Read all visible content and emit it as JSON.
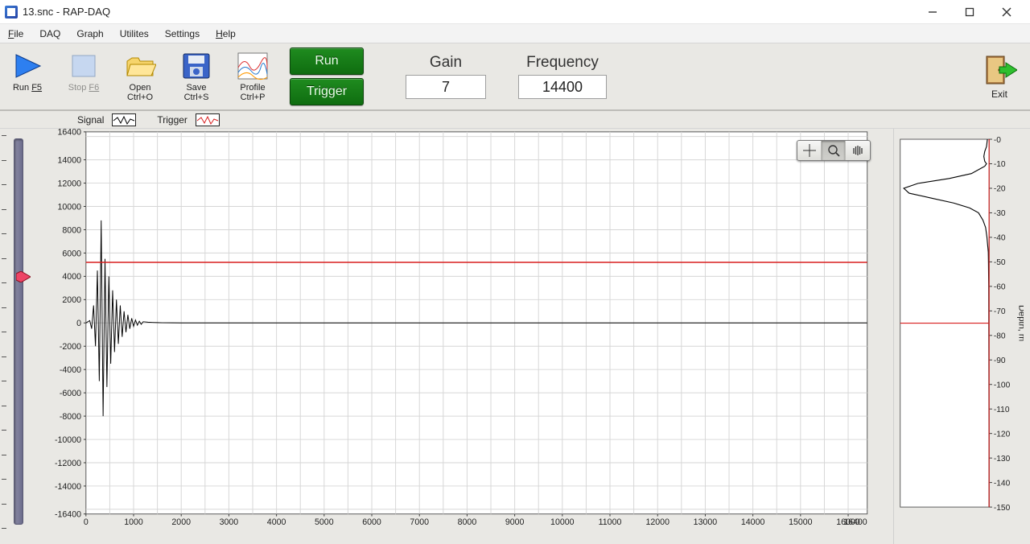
{
  "window": {
    "title": "13.snc  -  RAP-DAQ"
  },
  "menubar": [
    {
      "label": "File",
      "accel": "F"
    },
    {
      "label": "DAQ",
      "accel": ""
    },
    {
      "label": "Graph",
      "accel": ""
    },
    {
      "label": "Utilites",
      "accel": ""
    },
    {
      "label": "Settings",
      "accel": ""
    },
    {
      "label": "Help",
      "accel": "H"
    }
  ],
  "toolbar": {
    "run": {
      "label": "Run ",
      "key": "F5"
    },
    "stop": {
      "label": "Stop ",
      "key": "F6"
    },
    "open": {
      "label": "Open\nCtrl+O"
    },
    "save": {
      "label": "Save\nCtrl+S"
    },
    "profile": {
      "label": "Profile\nCtrl+P"
    },
    "run_btn": "Run",
    "trigger_btn": "Trigger",
    "gain_label": "Gain",
    "gain_value": "7",
    "freq_label": "Frequency",
    "freq_value": "14400",
    "exit_label": "Exit"
  },
  "legend": {
    "signal": "Signal",
    "trigger": "Trigger"
  },
  "depth_axis_label": "Depth, m",
  "chart_data": [
    {
      "type": "line",
      "title": "",
      "xlabel": "",
      "ylabel": "",
      "xlim": [
        0,
        16400
      ],
      "ylim": [
        -16400,
        16400
      ],
      "xticks": [
        0,
        1000,
        2000,
        3000,
        4000,
        5000,
        6000,
        7000,
        8000,
        9000,
        10000,
        11000,
        12000,
        13000,
        14000,
        15000,
        16000,
        16400
      ],
      "yticks": [
        -16400,
        -14000,
        -12000,
        -10000,
        -8000,
        -6000,
        -4000,
        -2000,
        0,
        2000,
        4000,
        6000,
        8000,
        10000,
        12000,
        14000,
        16400
      ],
      "series": [
        {
          "name": "Signal",
          "color": "#000000",
          "x": [
            0,
            80,
            120,
            160,
            200,
            240,
            280,
            320,
            360,
            400,
            440,
            480,
            520,
            560,
            600,
            640,
            680,
            720,
            760,
            800,
            840,
            880,
            920,
            960,
            1000,
            1040,
            1080,
            1120,
            1160,
            1200,
            1300,
            1400,
            1500,
            1600,
            1800,
            2000,
            2500,
            3000,
            4000,
            5000,
            7000,
            9000,
            12000,
            16400
          ],
          "values": [
            0,
            200,
            -500,
            1500,
            -2000,
            4500,
            -5000,
            8800,
            -8000,
            5500,
            -5500,
            4000,
            -3500,
            2800,
            -2500,
            2000,
            -1800,
            1500,
            -1200,
            1000,
            -800,
            700,
            -500,
            400,
            -300,
            250,
            -200,
            150,
            -120,
            100,
            60,
            40,
            25,
            15,
            10,
            5,
            3,
            0,
            2,
            0,
            1,
            0,
            0,
            0
          ]
        },
        {
          "name": "Trigger",
          "color": "#d81e1e",
          "x": [
            0,
            16400
          ],
          "values": [
            5200,
            5200
          ]
        }
      ]
    },
    {
      "type": "line",
      "title": "",
      "xlabel": "",
      "ylabel": "Depth, m",
      "xlim": [
        0,
        1
      ],
      "ylim": [
        150,
        0
      ],
      "yticks": [
        0,
        10,
        20,
        30,
        40,
        50,
        60,
        70,
        80,
        90,
        100,
        110,
        120,
        130,
        140,
        150
      ],
      "series": [
        {
          "name": "Profile",
          "color": "#000000",
          "y": [
            0,
            3,
            5,
            7,
            9,
            10,
            11,
            12,
            14,
            16,
            18,
            20,
            22,
            24,
            26,
            28,
            30,
            33,
            36,
            40,
            44,
            46,
            50,
            60,
            80,
            100,
            120,
            150
          ],
          "values": [
            0.98,
            0.97,
            0.95,
            0.94,
            0.95,
            0.97,
            0.95,
            0.9,
            0.8,
            0.55,
            0.2,
            0.04,
            0.1,
            0.35,
            0.6,
            0.78,
            0.88,
            0.93,
            0.96,
            0.975,
            0.985,
            0.99,
            0.992,
            0.995,
            0.996,
            0.997,
            0.998,
            0.998
          ]
        },
        {
          "name": "Marker",
          "color": "#d81e1e",
          "y": [
            75,
            75
          ],
          "values": [
            0,
            1
          ]
        },
        {
          "name": "RightEdge",
          "color": "#d81e1e",
          "y": [
            0,
            150
          ],
          "values": [
            0.999,
            0.999
          ]
        }
      ]
    }
  ]
}
